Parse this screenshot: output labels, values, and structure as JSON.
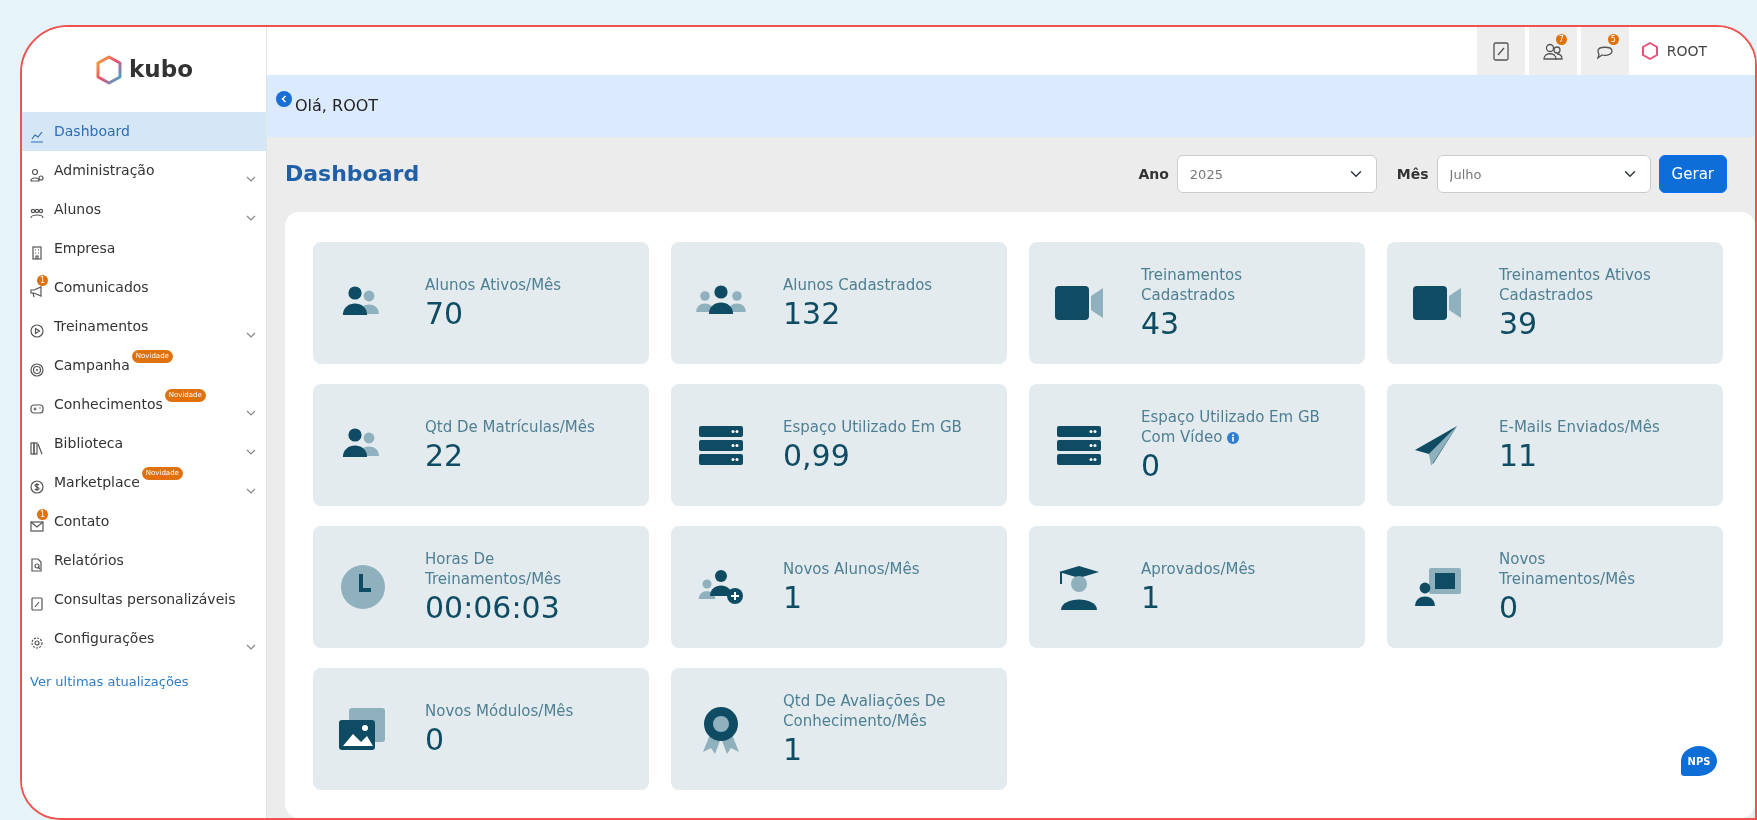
{
  "logo": {
    "text": "kubo"
  },
  "sidebar": {
    "items": [
      {
        "label": "Dashboard",
        "selected": true,
        "submenu": false
      },
      {
        "label": "Administração",
        "selected": false,
        "submenu": true
      },
      {
        "label": "Alunos",
        "selected": false,
        "submenu": true
      },
      {
        "label": "Empresa",
        "selected": false,
        "submenu": false
      },
      {
        "label": "Comunicados",
        "selected": false,
        "submenu": false,
        "badge": "1"
      },
      {
        "label": "Treinamentos",
        "selected": false,
        "submenu": true
      },
      {
        "label": "Campanha",
        "selected": false,
        "submenu": false,
        "tag": "Novidade"
      },
      {
        "label": "Conhecimentos",
        "selected": false,
        "submenu": true,
        "tag": "Novidade"
      },
      {
        "label": "Biblioteca",
        "selected": false,
        "submenu": true
      },
      {
        "label": "Marketplace",
        "selected": false,
        "submenu": true,
        "tag": "Novidade"
      },
      {
        "label": "Contato",
        "selected": false,
        "submenu": false,
        "badge": "1"
      },
      {
        "label": "Relatórios",
        "selected": false,
        "submenu": false
      },
      {
        "label": "Consultas personalizáveis",
        "selected": false,
        "submenu": false
      },
      {
        "label": "Configurações",
        "selected": false,
        "submenu": true
      }
    ],
    "link": "Ver ultimas atualizações"
  },
  "topbar": {
    "buttons": [
      {
        "kind": "document"
      },
      {
        "kind": "users",
        "badge": "7"
      },
      {
        "kind": "chat",
        "badge": "5"
      }
    ],
    "user": "ROOT"
  },
  "greeting": "Olá, ROOT",
  "page_title": "Dashboard",
  "filters": [
    {
      "label": "Ano",
      "value": "2025"
    },
    {
      "label": "Mês",
      "value": "Julho"
    }
  ],
  "generate_button": "Gerar",
  "cards": [
    {
      "title": "Alunos Ativos/Mês",
      "value": "70"
    },
    {
      "title": "Alunos Cadastrados",
      "value": "132"
    },
    {
      "title": "Treinamentos Cadastrados",
      "value": "43"
    },
    {
      "title": "Treinamentos Ativos Cadastrados",
      "value": "39"
    },
    {
      "title": "Qtd De Matrículas/Mês",
      "value": "22"
    },
    {
      "title": "Espaço Utilizado Em GB",
      "value": "0,99"
    },
    {
      "title": "Espaço Utilizado Em GB Com Vídeo",
      "value": "0",
      "info": true
    },
    {
      "title": "E-Mails Enviados/Mês",
      "value": "11"
    },
    {
      "title": "Horas De Treinamentos/Mês",
      "value": "00:06:03"
    },
    {
      "title": "Novos Alunos/Mês",
      "value": "1"
    },
    {
      "title": "Aprovados/Mês",
      "value": "1"
    },
    {
      "title": "Novos Treinamentos/Mês",
      "value": "0"
    },
    {
      "title": "Novos Módulos/Mês",
      "value": "0"
    },
    {
      "title": "Qtd De Avaliações De Conhecimento/Mês",
      "value": "1"
    }
  ],
  "nps_button": "NPS"
}
